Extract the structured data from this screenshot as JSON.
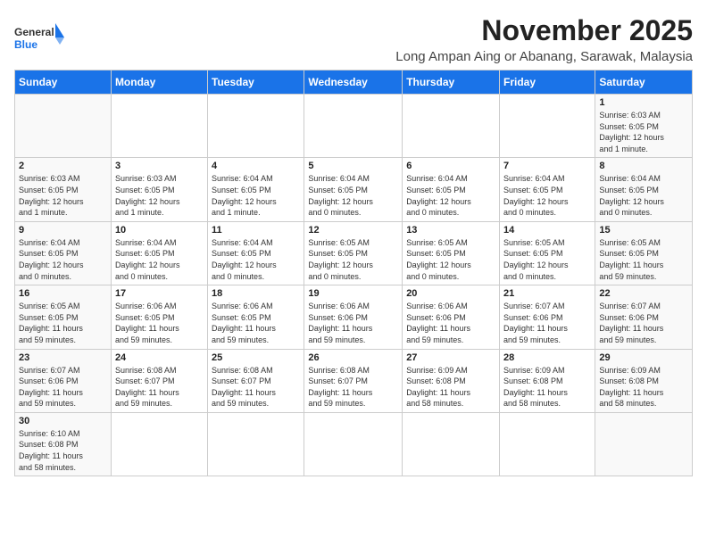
{
  "header": {
    "logo_general": "General",
    "logo_blue": "Blue",
    "month_title": "November 2025",
    "location": "Long Ampan Aing or Abanang, Sarawak, Malaysia"
  },
  "weekdays": [
    "Sunday",
    "Monday",
    "Tuesday",
    "Wednesday",
    "Thursday",
    "Friday",
    "Saturday"
  ],
  "weeks": [
    [
      {
        "day": "",
        "info": ""
      },
      {
        "day": "",
        "info": ""
      },
      {
        "day": "",
        "info": ""
      },
      {
        "day": "",
        "info": ""
      },
      {
        "day": "",
        "info": ""
      },
      {
        "day": "",
        "info": ""
      },
      {
        "day": "1",
        "info": "Sunrise: 6:03 AM\nSunset: 6:05 PM\nDaylight: 12 hours\nand 1 minute."
      }
    ],
    [
      {
        "day": "2",
        "info": "Sunrise: 6:03 AM\nSunset: 6:05 PM\nDaylight: 12 hours\nand 1 minute."
      },
      {
        "day": "3",
        "info": "Sunrise: 6:03 AM\nSunset: 6:05 PM\nDaylight: 12 hours\nand 1 minute."
      },
      {
        "day": "4",
        "info": "Sunrise: 6:04 AM\nSunset: 6:05 PM\nDaylight: 12 hours\nand 1 minute."
      },
      {
        "day": "5",
        "info": "Sunrise: 6:04 AM\nSunset: 6:05 PM\nDaylight: 12 hours\nand 0 minutes."
      },
      {
        "day": "6",
        "info": "Sunrise: 6:04 AM\nSunset: 6:05 PM\nDaylight: 12 hours\nand 0 minutes."
      },
      {
        "day": "7",
        "info": "Sunrise: 6:04 AM\nSunset: 6:05 PM\nDaylight: 12 hours\nand 0 minutes."
      },
      {
        "day": "8",
        "info": "Sunrise: 6:04 AM\nSunset: 6:05 PM\nDaylight: 12 hours\nand 0 minutes."
      }
    ],
    [
      {
        "day": "9",
        "info": "Sunrise: 6:04 AM\nSunset: 6:05 PM\nDaylight: 12 hours\nand 0 minutes."
      },
      {
        "day": "10",
        "info": "Sunrise: 6:04 AM\nSunset: 6:05 PM\nDaylight: 12 hours\nand 0 minutes."
      },
      {
        "day": "11",
        "info": "Sunrise: 6:04 AM\nSunset: 6:05 PM\nDaylight: 12 hours\nand 0 minutes."
      },
      {
        "day": "12",
        "info": "Sunrise: 6:05 AM\nSunset: 6:05 PM\nDaylight: 12 hours\nand 0 minutes."
      },
      {
        "day": "13",
        "info": "Sunrise: 6:05 AM\nSunset: 6:05 PM\nDaylight: 12 hours\nand 0 minutes."
      },
      {
        "day": "14",
        "info": "Sunrise: 6:05 AM\nSunset: 6:05 PM\nDaylight: 12 hours\nand 0 minutes."
      },
      {
        "day": "15",
        "info": "Sunrise: 6:05 AM\nSunset: 6:05 PM\nDaylight: 11 hours\nand 59 minutes."
      }
    ],
    [
      {
        "day": "16",
        "info": "Sunrise: 6:05 AM\nSunset: 6:05 PM\nDaylight: 11 hours\nand 59 minutes."
      },
      {
        "day": "17",
        "info": "Sunrise: 6:06 AM\nSunset: 6:05 PM\nDaylight: 11 hours\nand 59 minutes."
      },
      {
        "day": "18",
        "info": "Sunrise: 6:06 AM\nSunset: 6:05 PM\nDaylight: 11 hours\nand 59 minutes."
      },
      {
        "day": "19",
        "info": "Sunrise: 6:06 AM\nSunset: 6:06 PM\nDaylight: 11 hours\nand 59 minutes."
      },
      {
        "day": "20",
        "info": "Sunrise: 6:06 AM\nSunset: 6:06 PM\nDaylight: 11 hours\nand 59 minutes."
      },
      {
        "day": "21",
        "info": "Sunrise: 6:07 AM\nSunset: 6:06 PM\nDaylight: 11 hours\nand 59 minutes."
      },
      {
        "day": "22",
        "info": "Sunrise: 6:07 AM\nSunset: 6:06 PM\nDaylight: 11 hours\nand 59 minutes."
      }
    ],
    [
      {
        "day": "23",
        "info": "Sunrise: 6:07 AM\nSunset: 6:06 PM\nDaylight: 11 hours\nand 59 minutes."
      },
      {
        "day": "24",
        "info": "Sunrise: 6:08 AM\nSunset: 6:07 PM\nDaylight: 11 hours\nand 59 minutes."
      },
      {
        "day": "25",
        "info": "Sunrise: 6:08 AM\nSunset: 6:07 PM\nDaylight: 11 hours\nand 59 minutes."
      },
      {
        "day": "26",
        "info": "Sunrise: 6:08 AM\nSunset: 6:07 PM\nDaylight: 11 hours\nand 59 minutes."
      },
      {
        "day": "27",
        "info": "Sunrise: 6:09 AM\nSunset: 6:08 PM\nDaylight: 11 hours\nand 58 minutes."
      },
      {
        "day": "28",
        "info": "Sunrise: 6:09 AM\nSunset: 6:08 PM\nDaylight: 11 hours\nand 58 minutes."
      },
      {
        "day": "29",
        "info": "Sunrise: 6:09 AM\nSunset: 6:08 PM\nDaylight: 11 hours\nand 58 minutes."
      }
    ],
    [
      {
        "day": "30",
        "info": "Sunrise: 6:10 AM\nSunset: 6:08 PM\nDaylight: 11 hours\nand 58 minutes."
      },
      {
        "day": "",
        "info": ""
      },
      {
        "day": "",
        "info": ""
      },
      {
        "day": "",
        "info": ""
      },
      {
        "day": "",
        "info": ""
      },
      {
        "day": "",
        "info": ""
      },
      {
        "day": "",
        "info": ""
      }
    ]
  ]
}
